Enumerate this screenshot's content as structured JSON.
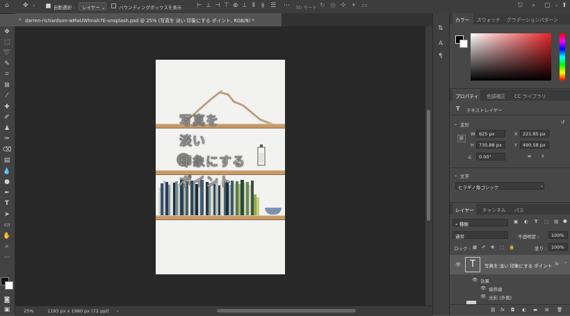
{
  "options_bar": {
    "auto_select_label": "自動選択 :",
    "auto_select_target": "レイヤー",
    "show_bbox_label": "バウンディングボックスを表示",
    "mode_3d_label": "3D モード :"
  },
  "document_tab": {
    "title": "darren-richardson-wMaUWhnah7E-unsplash.psd @ 25% (写真を 淡い 印象にする ポイント, RGB/8) *"
  },
  "canvas": {
    "text_lines": [
      "写真を",
      "淡い",
      "印象にする",
      "ポイント"
    ]
  },
  "status_bar": {
    "zoom": "25%",
    "doc_info": "1193 px x 1980 px (72 ppi)"
  },
  "color_panel": {
    "tabs": [
      "カラー",
      "スウォッチ",
      "グラデーション",
      "パターン"
    ]
  },
  "properties_panel": {
    "tabs": [
      "プロパティ",
      "色調補正",
      "CC ライブラリ"
    ],
    "layer_kind": "テキストレイヤー",
    "transform_label": "変形",
    "w_label": "W",
    "w_value": "625 px",
    "h_label": "H",
    "h_value": "735.88 px",
    "x_label": "X",
    "x_value": "221.85 px",
    "y_label": "Y",
    "y_value": "490.58 px",
    "angle_value": "0.00°",
    "char_label": "文字",
    "font_value": "ヒラギノ角ゴシック"
  },
  "layers_panel": {
    "tabs": [
      "レイヤー",
      "チャンネル",
      "パス"
    ],
    "filter_kind": "種類",
    "blend_mode": "通常",
    "opacity_label": "不透明度 :",
    "opacity_value": "100%",
    "lock_label": "ロック :",
    "fill_label": "塗り :",
    "fill_value": "100%",
    "layer_name": "写真を 淡い 印象にする ポイント",
    "fx_label": "fx",
    "effects_label": "効果",
    "effect_stroke": "境界線",
    "effect_glow": "光彩 (外側)",
    "footer_fx": "fx"
  },
  "colors": {
    "accent_red": "#e5252a",
    "shelf_wood": "#c79a6a"
  }
}
